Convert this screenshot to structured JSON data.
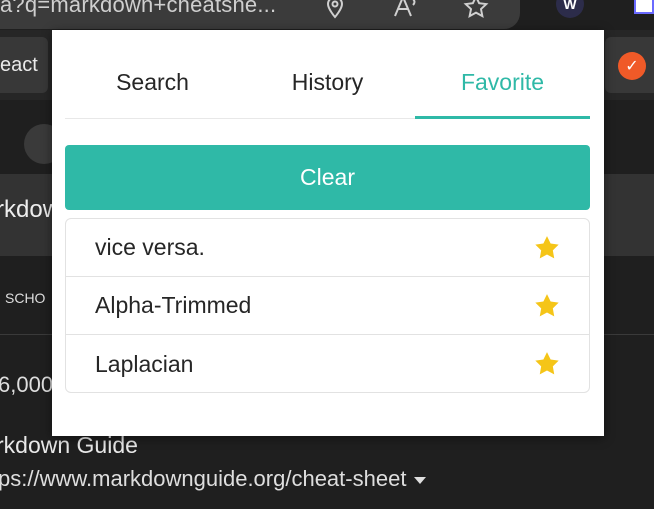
{
  "browser": {
    "url_text": "a?q=markdown+cheatshe...",
    "icons": [
      "location-icon",
      "read-aloud-icon",
      "favorite-star-icon",
      "extension-icon",
      "extension-icon-2"
    ],
    "bookmark_left": "eact",
    "page_heading": "rkdow",
    "page_nav": "SCHO",
    "page_count": "6,000",
    "result_title": "rkdown Guide",
    "result_url": "ps://www.markdownguide.org/cheat-sheet"
  },
  "popup": {
    "tabs": [
      {
        "label": "Search",
        "active": false
      },
      {
        "label": "History",
        "active": false
      },
      {
        "label": "Favorite",
        "active": true
      }
    ],
    "clear_label": "Clear",
    "favorites": [
      {
        "text": "vice versa.",
        "icon": "star-icon"
      },
      {
        "text": "Alpha-Trimmed",
        "icon": "star-icon"
      },
      {
        "text": "Laplacian",
        "icon": "star-icon"
      }
    ],
    "colors": {
      "accent": "#2fb9a7",
      "star": "#f5c518",
      "text": "#262626"
    }
  }
}
